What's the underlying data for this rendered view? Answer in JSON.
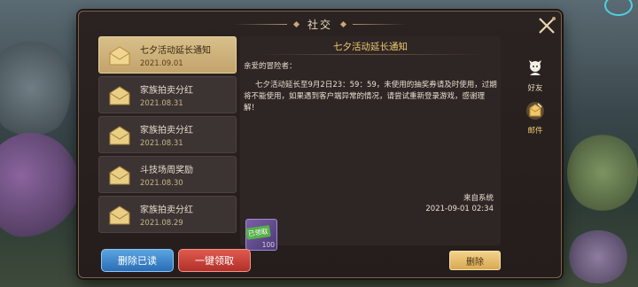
{
  "window": {
    "title": "社交"
  },
  "mail_list": [
    {
      "title": "七夕活动延长通知",
      "date": "2021.09.01",
      "active": true
    },
    {
      "title": "家族拍卖分红",
      "date": "2021.08.31",
      "active": false
    },
    {
      "title": "家族拍卖分红",
      "date": "2021.08.31",
      "active": false
    },
    {
      "title": "斗技场周奖励",
      "date": "2021.08.30",
      "active": false
    },
    {
      "title": "家族拍卖分红",
      "date": "2021.08.29",
      "active": false
    }
  ],
  "mail": {
    "title": "七夕活动延长至9月2日23：59：59，未使用的抽奖券请及时使用，过期将不能使用，如果遇到客户端异常的情况，请尝试重新登录游戏，感谢理解！",
    "subject": "七夕活动延长通知",
    "greeting": "亲爱的冒险者：",
    "from": "来自系统",
    "time": "2021-09-01  02:34",
    "attachment": {
      "badge": "已领取",
      "count": "100"
    }
  },
  "side_tabs": [
    {
      "label": "好友",
      "icon": "friend-icon"
    },
    {
      "label": "邮件",
      "icon": "mail-icon",
      "active": true
    }
  ],
  "buttons": {
    "delete_read": "删除已读",
    "claim_all": "一键领取",
    "delete": "删除"
  },
  "colors": {
    "accent_gold": "#f0c870",
    "active_item": "#d8bf89",
    "button_blue": "#2a6db6",
    "button_red": "#b0302a"
  }
}
